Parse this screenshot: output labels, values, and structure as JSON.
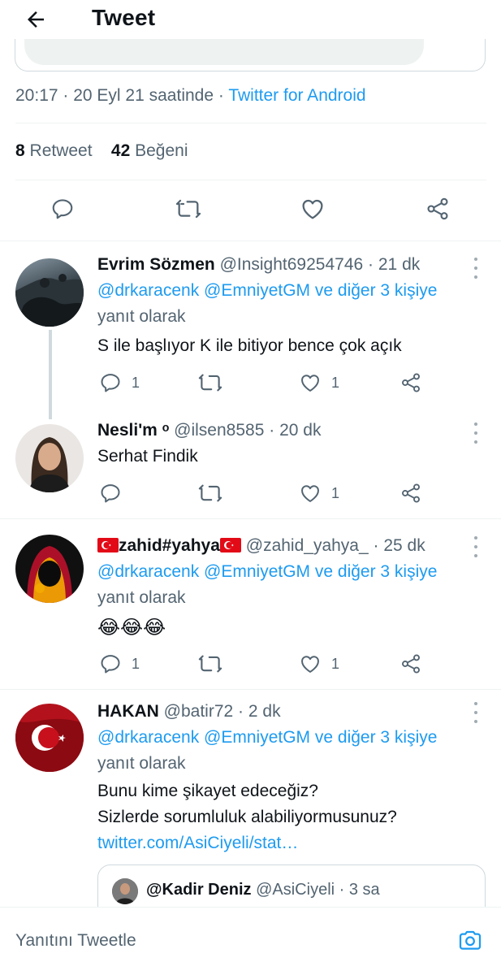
{
  "header": {
    "title": "Tweet"
  },
  "tweet": {
    "time": "20:17",
    "date_suffix": "20 Eyl 21 saatinde",
    "source": "Twitter for Android",
    "retweet_count": "8",
    "retweet_label": "Retweet",
    "like_count": "42",
    "like_label": "Beğeni"
  },
  "replies": [
    {
      "name": "Evrim Sözmen",
      "handle": "@Insight69254746",
      "age": "21 dk",
      "mention": "@drkaracenk @EmniyetGM ve diğer 3 kişiye",
      "reply_to": "yanıt olarak",
      "text": "S ile başlıyor K ile bitiyor bence çok açık",
      "reply_count": "1",
      "like_count": "1"
    },
    {
      "name": "Nesli'm ᵒ",
      "handle": "@ilsen8585",
      "age": "20 dk",
      "text": "Serhat Findik",
      "like_count": "1"
    },
    {
      "name": "zahid#yahya",
      "handle": "@zahid_yahya_",
      "age": "25 dk",
      "mention": "@drkaracenk @EmniyetGM ve diğer 3 kişiye",
      "reply_to": "yanıt olarak",
      "text": "😂😂😂",
      "reply_count": "1",
      "like_count": "1"
    },
    {
      "name": "HAKAN",
      "handle": "@batir72",
      "age": "2 dk",
      "mention": "@drkaracenk @EmniyetGM ve diğer 3 kişiye",
      "reply_to": "yanıt olarak",
      "text_line1": "Bunu kime şikayet edeceğiz?",
      "text_line2": "Sizlerde sorumluluk alabiliyormusunuz?",
      "link": "twitter.com/AsiCiyeli/stat…",
      "quoted": {
        "name": "@Kadir Deniz",
        "handle": "@AsiCiyeli",
        "age": "3 sa"
      }
    }
  ],
  "composer": {
    "placeholder": "Yanıtını Tweetle"
  },
  "colors": {
    "accent": "#1d9bf0",
    "text": "#0f1419",
    "muted": "#536471",
    "divider": "#eff3f4"
  },
  "icons": [
    "back-arrow-icon",
    "reply-icon",
    "retweet-icon",
    "like-icon",
    "share-icon",
    "more-icon",
    "camera-icon"
  ]
}
